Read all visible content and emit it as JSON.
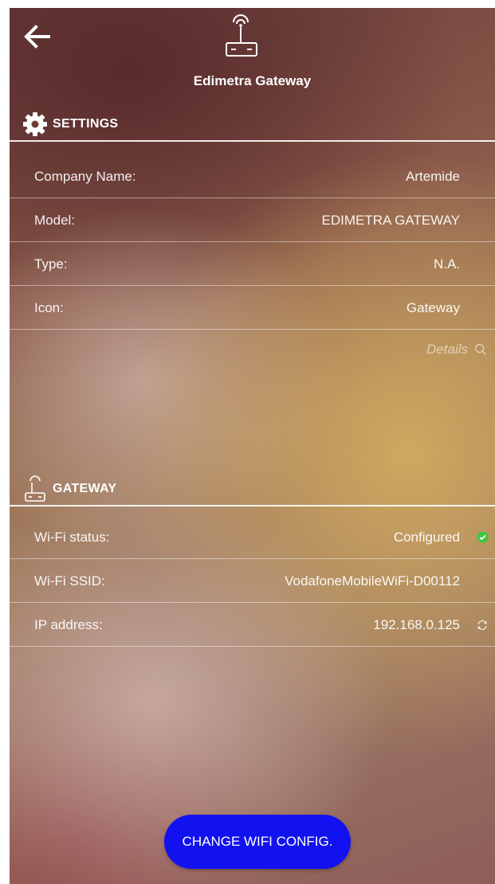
{
  "header": {
    "title": "Edimetra Gateway",
    "icon": "router-antenna-icon",
    "back_icon": "arrow-left-icon"
  },
  "settings": {
    "title": "SETTINGS",
    "icon": "gear-icon",
    "rows": [
      {
        "label": "Company Name:",
        "value": "Artemide"
      },
      {
        "label": "Model:",
        "value": "EDIMETRA GATEWAY"
      },
      {
        "label": "Type:",
        "value": "N.A."
      },
      {
        "label": "Icon:",
        "value": "Gateway"
      }
    ],
    "details_label": "Details",
    "details_icon": "search-icon"
  },
  "gateway": {
    "title": "GATEWAY",
    "icon": "router-antenna-icon",
    "rows": [
      {
        "label": "Wi-Fi status:",
        "value": "Configured",
        "status_icon": "check-circle-icon"
      },
      {
        "label": "Wi-Fi SSID:",
        "value": "VodafoneMobileWiFi-D00112"
      },
      {
        "label": "IP address:",
        "value": "192.168.0.125",
        "status_icon": "refresh-icon"
      }
    ]
  },
  "action": {
    "label": "CHANGE WIFI CONFIG."
  },
  "colors": {
    "button": "#1212f0",
    "status_ok": "#3cc83c",
    "text": "#ffffff"
  }
}
